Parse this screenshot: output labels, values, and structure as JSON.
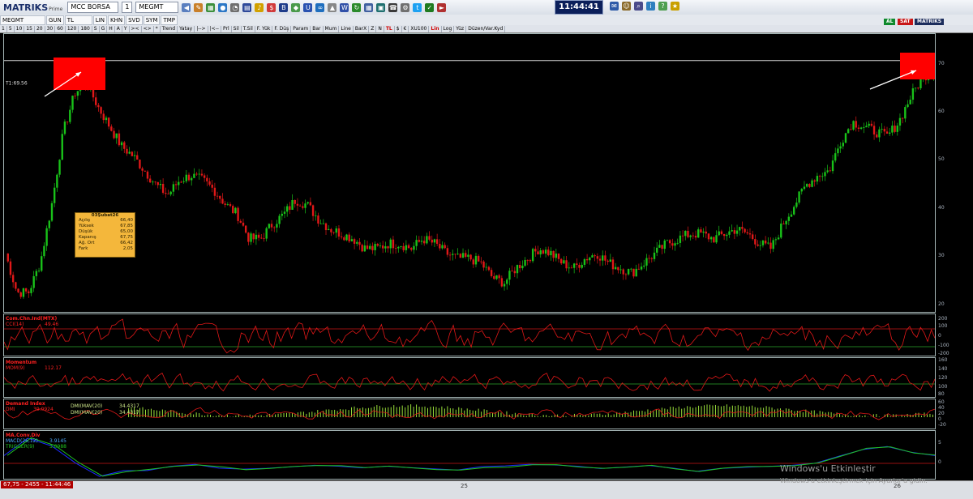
{
  "app": {
    "logo": "MATRIKS",
    "edition": "Prime",
    "clock": "11:44:41"
  },
  "toolbar": {
    "symbol1": "MEGMT",
    "tab_gun": "GUN",
    "tab_tl": "TL",
    "market": "MCC BORSA",
    "window_no": "1",
    "symbol2": "MEGMT"
  },
  "periods": [
    "1",
    "5",
    "10",
    "15",
    "20",
    "30",
    "60",
    "120",
    "180",
    "S",
    "G",
    "H",
    "A",
    "Y",
    ">< ",
    "<>",
    "*",
    "Trend",
    "Yatay",
    "|-->",
    "|<--",
    "Prl",
    "Sil",
    "T.Sil",
    "F. Yük",
    "F. Düş",
    "Param",
    "Bar",
    "Mum",
    "Line",
    "BarX",
    "Z",
    "N",
    "TL",
    "$",
    "€",
    "XU100",
    "Lin",
    "Log",
    "Yüz",
    "Düzen/Var.Kyd"
  ],
  "row2": {
    "sym": "MEGMT",
    "tabs": [
      "GUN",
      "TL",
      "LIN",
      "KHN",
      "SVD",
      "SYM",
      "TMP"
    ]
  },
  "status_flags": {
    "al": "AL",
    "sat": "SAT",
    "brand": "MATRIKS"
  },
  "price_axis": [
    "70",
    "60",
    "50",
    "40",
    "30",
    "20"
  ],
  "price_line_label": "T1:69.56",
  "info_box": {
    "date": "03Şubat26",
    "rows": [
      {
        "k": "Açılış",
        "v": "66,40"
      },
      {
        "k": "Yüksek",
        "v": "67,85"
      },
      {
        "k": "Düşük",
        "v": "65,00"
      },
      {
        "k": "Kapanış",
        "v": "67,75"
      },
      {
        "k": "Ağ. Ort",
        "v": "66,42"
      },
      {
        "k": "Fark",
        "v": "2,05"
      }
    ]
  },
  "indicators": {
    "cci": {
      "title": "Com.Chn.Ind(MTX)",
      "line": "CCI(14)",
      "value": "49.46",
      "axis": [
        "200",
        "100",
        "0",
        "-100",
        "-200"
      ]
    },
    "momentum": {
      "title": "Momentum",
      "line": "MOM(9)",
      "value": "112.17",
      "axis": [
        "160",
        "140",
        "120",
        "100",
        "80"
      ]
    },
    "dmi": {
      "title": "Demand Index",
      "line": "DMI",
      "value": "39.0924",
      "line2": "DMI(MAV(20)",
      "value2": "34.4317",
      "line3": "DMI(MAV(20)",
      "value3": "34.4317",
      "axis": [
        "60",
        "40",
        "20",
        "0",
        "-20"
      ]
    },
    "macd": {
      "title": "MA.Conv.Div",
      "line": "MACD(26,12)",
      "value": "3.9145",
      "line2": "TRIGGER(9)",
      "value2": "3.0988",
      "axis": [
        "5",
        "0"
      ]
    }
  },
  "status": {
    "left": "67,75 - 2455 - 11:44:46"
  },
  "time_axis": [
    "25",
    "26"
  ],
  "watermark": {
    "line1": "Windows'u Etkinleştir",
    "line2": "Windows'u etkinleştirmek için Ayarlar'a gidin."
  },
  "colors": {
    "up": "#19c219",
    "down": "#e01818",
    "highlight": "#ff0000",
    "cci": "#e01818",
    "macd": "#1a2cff",
    "signal": "#21c421",
    "dmi_bar": "#9adf3a"
  },
  "chart_data": {
    "type": "candlestick",
    "y_axis_ticks": [
      20,
      30,
      40,
      50,
      60,
      70
    ],
    "ylim": [
      18,
      75
    ],
    "close_series_approx": [
      30,
      22,
      22,
      28,
      40,
      55,
      63,
      65,
      60,
      56,
      52,
      50,
      47,
      44,
      42,
      45,
      46,
      45,
      43,
      40,
      38,
      33,
      33,
      36,
      38,
      41,
      40,
      37,
      35,
      34,
      33,
      31,
      31,
      32,
      32,
      31,
      33,
      32,
      30,
      29,
      29,
      28,
      25,
      24,
      27,
      29,
      31,
      30,
      28,
      27,
      29,
      30,
      28,
      27,
      26,
      28,
      30,
      32,
      33,
      34,
      34,
      33,
      34,
      35,
      34,
      32,
      31,
      36,
      40,
      44,
      46,
      47,
      53,
      57,
      56,
      55,
      54,
      57,
      62,
      66,
      67.75
    ],
    "resistance_line": 69.56
  }
}
